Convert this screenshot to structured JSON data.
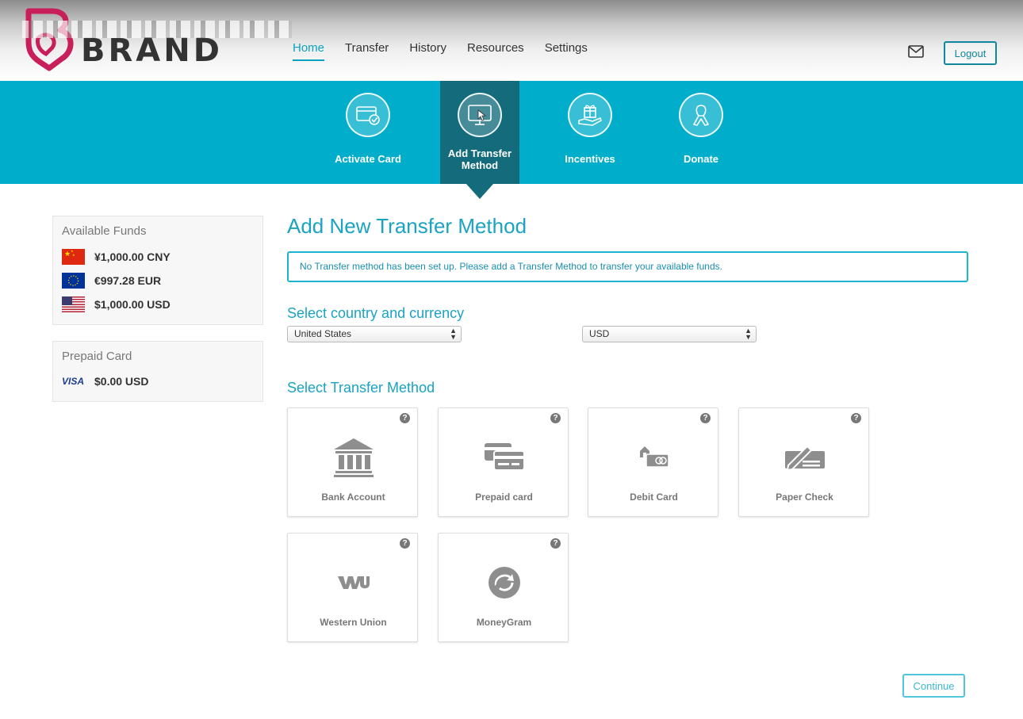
{
  "header": {
    "brand_name": "BRAND",
    "nav": [
      {
        "label": "Home",
        "active": true
      },
      {
        "label": "Transfer"
      },
      {
        "label": "History"
      },
      {
        "label": "Resources"
      },
      {
        "label": "Settings"
      }
    ],
    "mail_icon": "envelope-icon",
    "logout_label": "Logout"
  },
  "actions": [
    {
      "label": "Activate Card",
      "icon": "card-check-icon"
    },
    {
      "label": "Add Transfer Method",
      "icon": "monitor-cursor-icon",
      "active": true
    },
    {
      "label": "Incentives",
      "icon": "gift-hand-icon"
    },
    {
      "label": "Donate",
      "icon": "ribbon-icon"
    }
  ],
  "sidebar": {
    "funds_title": "Available Funds",
    "funds": [
      {
        "flag": "cn-flag-icon",
        "value": "¥1,000.00 CNY"
      },
      {
        "flag": "eu-flag-icon",
        "value": "€997.28 EUR"
      },
      {
        "flag": "us-flag-icon",
        "value": "$1,000.00 USD"
      }
    ],
    "prepaid_title": "Prepaid Card",
    "prepaid": {
      "brand": "VISA",
      "value": "$0.00 USD"
    }
  },
  "main": {
    "title": "Add New Transfer Method",
    "notice": "No Transfer method has been set up. Please add a Transfer Method to transfer your available funds.",
    "country_heading": "Select country and currency",
    "country_select": "United States",
    "currency_select": "USD",
    "method_heading": "Select Transfer Method",
    "methods": [
      {
        "label": "Bank Account",
        "icon": "bank-icon"
      },
      {
        "label": "Prepaid card",
        "icon": "prepaid-card-icon"
      },
      {
        "label": "Debit Card",
        "icon": "debit-card-icon"
      },
      {
        "label": "Paper Check",
        "icon": "check-pen-icon"
      },
      {
        "label": "Western Union",
        "icon": "wu-logo-icon"
      },
      {
        "label": "MoneyGram",
        "icon": "moneygram-logo-icon"
      }
    ],
    "continue_label": "Continue"
  },
  "colors": {
    "accent": "#00aecb",
    "accent_dark": "#136b7b",
    "heading": "#1aa3c2",
    "brand_pink": "#c81e5a"
  }
}
